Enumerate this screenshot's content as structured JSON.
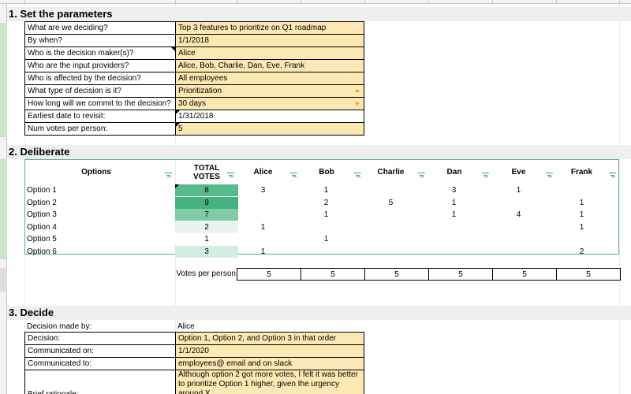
{
  "sections": {
    "parameters": "1. Set the parameters",
    "deliberate": "2. Deliberate",
    "decide": "3. Decide"
  },
  "parameters": [
    {
      "label": "What are we deciding?",
      "value": "Top 3 features to prioritize on Q1 roadmap"
    },
    {
      "label": "By when?",
      "value": "1/1/2018"
    },
    {
      "label": "Who is the decision maker(s)?",
      "value": "Alice"
    },
    {
      "label": "Who are the input providers?",
      "value": "Alice, Bob, Charlie, Dan, Eve, Frank"
    },
    {
      "label": "Who is affected by the decision?",
      "value": "All employees"
    },
    {
      "label": "What type of decision is it?",
      "value": "Prioritization"
    },
    {
      "label": "How long will we commit to the decision?",
      "value": "30 days"
    },
    {
      "label": "Earliest date to revisit:",
      "value": "1/31/2018"
    },
    {
      "label": "Num votes per person:",
      "value": "5"
    }
  ],
  "deliberate": {
    "headers": {
      "options": "Options",
      "total_line1": "TOTAL",
      "total_line2": "VOTES",
      "people": [
        "Alice",
        "Bob",
        "Charlie",
        "Dan",
        "Eve",
        "Frank"
      ]
    },
    "rows": [
      {
        "option": "Option 1",
        "total": "8",
        "votes": [
          "3",
          "1",
          "",
          "3",
          "1",
          ""
        ]
      },
      {
        "option": "Option 2",
        "total": "9",
        "votes": [
          "",
          "2",
          "5",
          "1",
          "",
          "1"
        ]
      },
      {
        "option": "Option 3",
        "total": "7",
        "votes": [
          "",
          "1",
          "",
          "1",
          "4",
          "1"
        ]
      },
      {
        "option": "Option 4",
        "total": "2",
        "votes": [
          "1",
          "",
          "",
          "",
          "",
          "1"
        ]
      },
      {
        "option": "Option 5",
        "total": "1",
        "votes": [
          "",
          "1",
          "",
          "",
          "",
          ""
        ]
      },
      {
        "option": "Option 6",
        "total": "3",
        "votes": [
          "1",
          "",
          "",
          "",
          "",
          "2"
        ]
      }
    ],
    "total_colors": [
      "#57bb8a",
      "#45b37f",
      "#7fcba5",
      "#e8f5ee",
      "#ffffff",
      "#d4ede0"
    ],
    "votes_per_person_label": "Votes per person",
    "votes_per_person": [
      "5",
      "5",
      "5",
      "5",
      "5",
      "5"
    ]
  },
  "decide": {
    "made_by_label": "Decision made by:",
    "made_by_value": "Alice",
    "rows": [
      {
        "label": "Decision:",
        "value": "Option 1, Option 2, and Option 3 in that order"
      },
      {
        "label": "Communicated on:",
        "value": "1/1/2020"
      },
      {
        "label": "Communicated to:",
        "value": "employees@ email and on slack"
      },
      {
        "label": "Brief rationale:",
        "value": "Although option 2 got more votes, I felt it was better to prioritize Option 1 higher, given the urgency around X."
      }
    ]
  }
}
